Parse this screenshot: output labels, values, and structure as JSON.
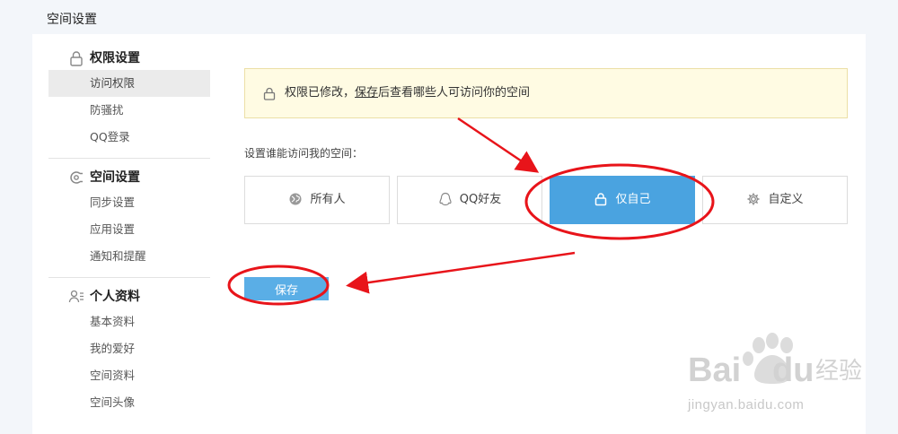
{
  "page": {
    "title": "空间设置"
  },
  "sidebar": {
    "sections": [
      {
        "title": "权限设置",
        "icon": "lock-icon",
        "items": [
          "访问权限",
          "防骚扰",
          "QQ登录"
        ]
      },
      {
        "title": "空间设置",
        "icon": "space-settings-icon",
        "items": [
          "同步设置",
          "应用设置",
          "通知和提醒"
        ]
      },
      {
        "title": "个人资料",
        "icon": "profile-icon",
        "items": [
          "基本资料",
          "我的爱好",
          "空间资料",
          "空间头像"
        ]
      }
    ]
  },
  "notice": {
    "prefix": "权限已修改，",
    "link": "保存",
    "suffix": "后查看哪些人可访问你的空间"
  },
  "visit": {
    "label": "设置谁能访问我的空间：",
    "options": [
      {
        "label": "所有人",
        "icon": "globe-icon"
      },
      {
        "label": "QQ好友",
        "icon": "qq-penguin-icon"
      },
      {
        "label": "仅自己",
        "icon": "lock-icon"
      },
      {
        "label": "自定义",
        "icon": "gear-icon"
      }
    ],
    "selected": "仅自己"
  },
  "actions": {
    "save_label": "保存"
  },
  "watermark": {
    "brand": "Bai du 经验",
    "url": "jingyan.baidu.com"
  },
  "colors": {
    "accent": "#4aa3e0",
    "annotation": "#e8141a",
    "notice_bg": "#fffbe3"
  }
}
